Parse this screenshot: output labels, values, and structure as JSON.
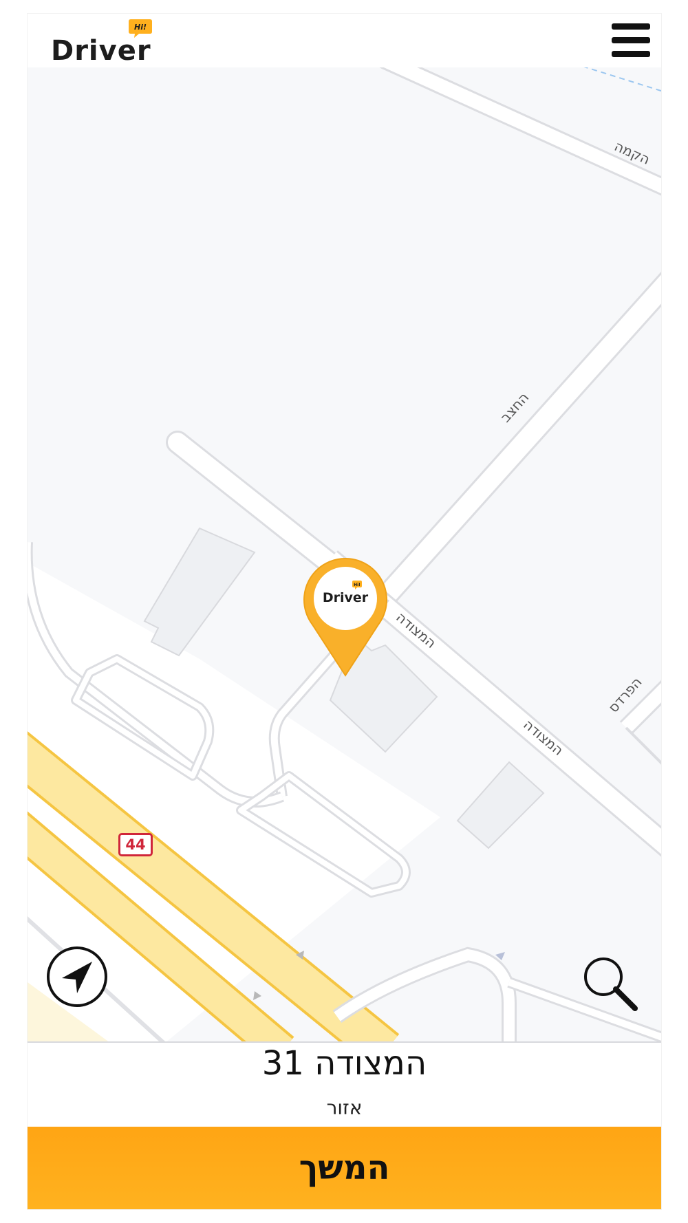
{
  "header": {
    "logo_text": "Driver",
    "logo_badge_text": "Hi!"
  },
  "map": {
    "streets": [
      {
        "name": "הקמה"
      },
      {
        "name": "החצב"
      },
      {
        "name": "המצודה"
      },
      {
        "name": "המצודה"
      },
      {
        "name": "הפרדס"
      }
    ],
    "route_number": "44",
    "pin_label": "Driver",
    "pin_badge_text": "Hi!"
  },
  "address": {
    "street": "המצודה 31",
    "area": "אזור"
  },
  "continue_label": "המשך",
  "colors": {
    "accent": "#FFA514",
    "highway": "#FDE8A0",
    "highway_edge": "#F5C542",
    "route_badge": "#D0263A"
  }
}
